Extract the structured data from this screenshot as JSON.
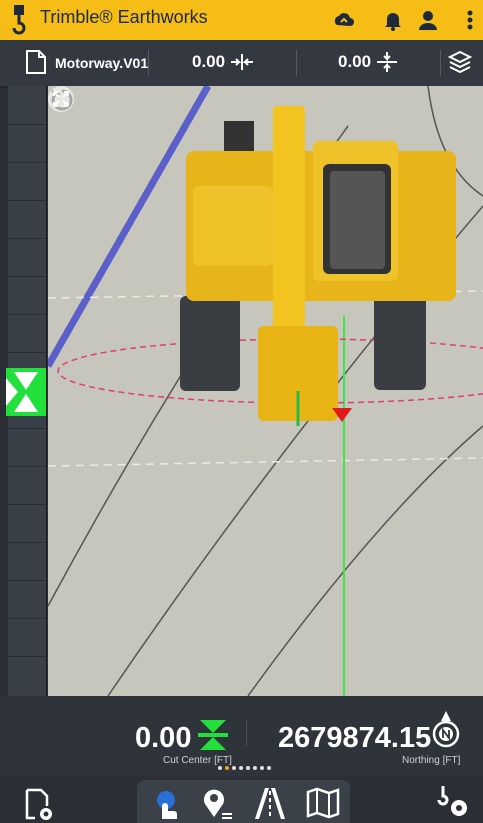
{
  "app": {
    "title": "Trimble® Earthworks"
  },
  "toolbar": {
    "filename": "Motorway.V01",
    "value1": "0.00",
    "value2": "0.00"
  },
  "readouts": {
    "cut_value": "0.00",
    "cut_label": "Cut Center [FT]",
    "northing_value": "2679874.15",
    "northing_label": "Northing [FT]"
  },
  "icons": {
    "top": [
      "crane-hook-logo",
      "cloud-sync-icon",
      "bell-icon",
      "user-icon",
      "more-vertical-icon"
    ],
    "nav": [
      "settings-doc-icon",
      "tap-mode-icon",
      "location-icon",
      "road-icon",
      "map-icon",
      "machine-settings-icon"
    ]
  },
  "colors": {
    "accent": "#f5bd16",
    "grade_green": "#22e03c"
  }
}
